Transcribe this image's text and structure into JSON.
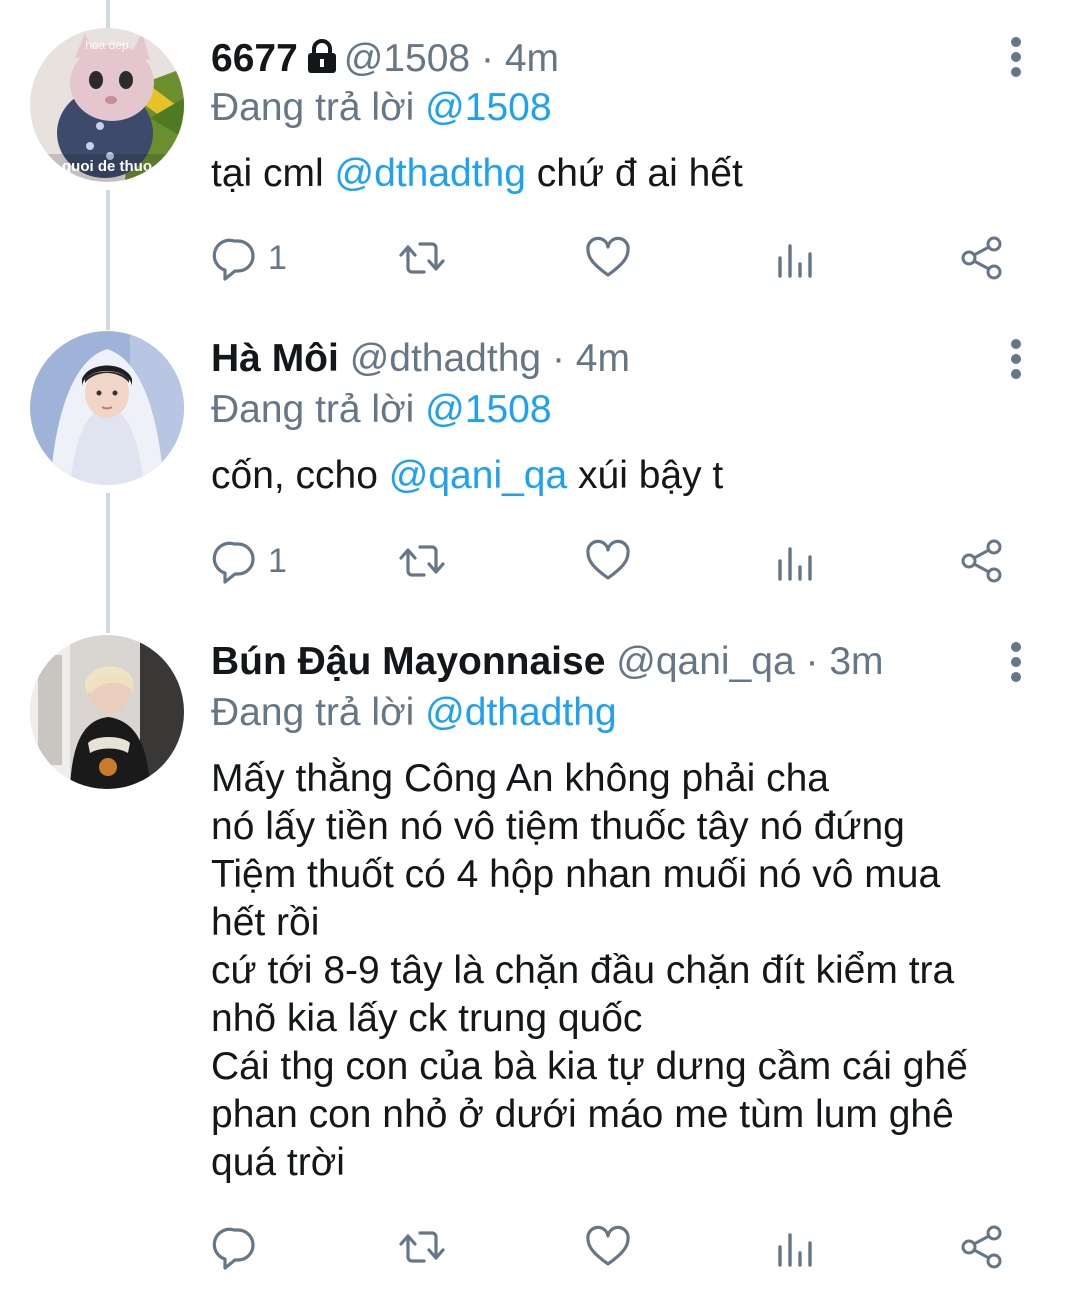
{
  "tweets": [
    {
      "name": "6677",
      "protected": true,
      "handle": "@1508",
      "separator": "·",
      "time": "4m",
      "reply_prefix": "Đang trả lời",
      "reply_to": "@1508",
      "body": {
        "pre": "tại cml ",
        "mention": "@dthadthg",
        "post": " chứ đ ai hết"
      },
      "reply_count": "1",
      "avatar_text_top": "hoa dep",
      "avatar_text_bottom": "quoi de thuo"
    },
    {
      "name": "Hà Môi",
      "protected": false,
      "handle": "@dthadthg",
      "separator": "·",
      "time": "4m",
      "reply_prefix": "Đang trả lời",
      "reply_to": "@1508",
      "body": {
        "pre": "cốn, ccho ",
        "mention": "@qani_qa",
        "post": " xúi bậy t"
      },
      "reply_count": "1"
    },
    {
      "name": "Bún Đậu Mayonnaise",
      "protected": false,
      "handle": "@qani_qa",
      "separator": "·",
      "time": "3m",
      "reply_prefix": "Đang trả lời",
      "reply_to": "@dthadthg",
      "body_lines": [
        "Mấy thằng Công An không phải cha",
        "nó lấy tiền nó vô tiệm thuốc tây nó đứng",
        "Tiệm thuốt có 4 hộp nhan muối nó vô mua",
        "hết rồi",
        "cứ tới 8-9 tây là chặn đầu chặn đít kiểm tra",
        "nhõ kia lấy ck trung quốc",
        "Cái thg con của bà kia tự dưng cầm cái ghế",
        "phan con nhỏ ở dưới máo me tùm lum ghê",
        "quá trời"
      ],
      "reply_count": ""
    }
  ],
  "icons": [
    "reply-icon",
    "retweet-icon",
    "like-icon",
    "analytics-icon",
    "share-icon",
    "more-icon",
    "lock-icon"
  ],
  "colors": {
    "text": "#14171a",
    "secondary": "#657786",
    "link": "#1da1f2",
    "thread_line": "#cfd9de"
  }
}
